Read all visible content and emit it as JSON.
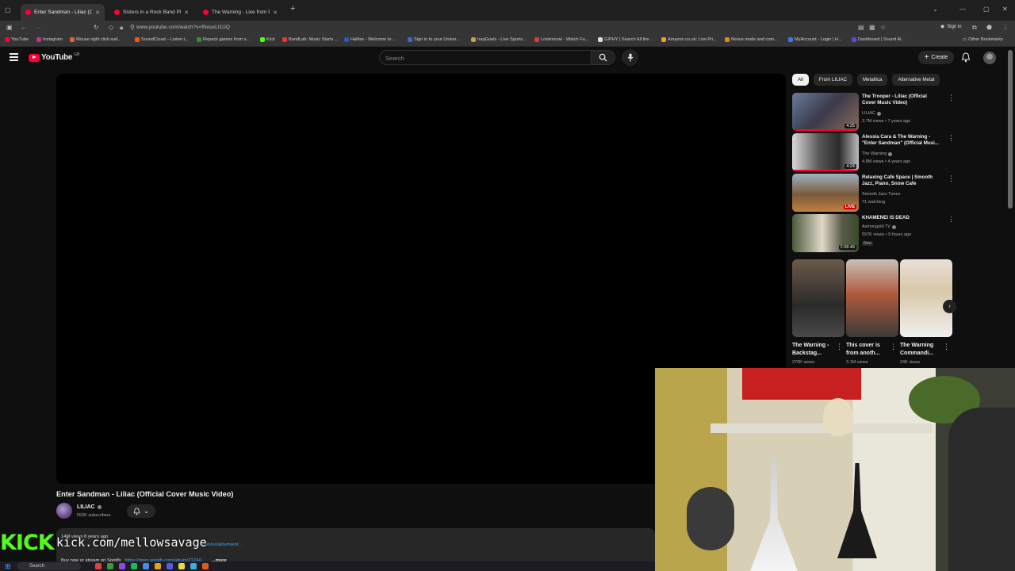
{
  "browser": {
    "tabs": [
      {
        "title": "Enter Sandman - Liliac (Official",
        "active": true
      },
      {
        "title": "Sisters in a Rock Band Play Trus",
        "active": false
      },
      {
        "title": "The Warning - Live from Pepsi",
        "active": false
      }
    ],
    "new_tab": "+",
    "url": "www.youtube.com/watch?v=fNouxLt1lJQ",
    "sign_in": "Sign in",
    "bookmarks": [
      {
        "label": "YouTube",
        "color": "#ff0033"
      },
      {
        "label": "Instagram",
        "color": "#c13584"
      },
      {
        "label": "Mouse right click sud...",
        "color": "#e0663a"
      },
      {
        "label": "SoundCloud – Listen t...",
        "color": "#ff5500"
      },
      {
        "label": "Repack games from s...",
        "color": "#3a8a3a"
      },
      {
        "label": "Kick",
        "color": "#53fc18"
      },
      {
        "label": "BandLab: Music Starts ...",
        "color": "#e03a3a"
      },
      {
        "label": "Halifax - Welcome to ...",
        "color": "#1f5fae"
      },
      {
        "label": "Sign in to your Univer...",
        "color": "#3a6bc9"
      },
      {
        "label": "IraqGoals - Live Sports...",
        "color": "#c9a03a"
      },
      {
        "label": "Lookmovie - Watch Fu...",
        "color": "#d04040"
      },
      {
        "label": "GIPHY | Search All the ...",
        "color": "#dddddd"
      },
      {
        "label": "Amazon.co.uk: Low Pri...",
        "color": "#f0a020"
      },
      {
        "label": "Nexus mods and com...",
        "color": "#e08a20"
      },
      {
        "label": "MyAccount - Login | H...",
        "color": "#3a7be0"
      },
      {
        "label": "Dashboard | Sound Al...",
        "color": "#5a4ae0"
      }
    ],
    "other_bookmarks": "Other Bookmarks"
  },
  "youtube": {
    "logo_word": "YouTube",
    "region": "GB",
    "search_placeholder": "Search",
    "create_label": "Create",
    "video": {
      "title": "Enter Sandman - Liliac (Official Cover Music Video)",
      "channel": "LILIAC",
      "subscribers": "552K subscribers",
      "meta": "14M views  8 years ago",
      "desc_link": ".com/us/album/ent...",
      "desc_line2": "Buy now or stream on Spotify",
      "desc_line2_link": "https://open.spotify.com/album/3TZ40..",
      "more": "...more"
    },
    "chips": [
      {
        "label": "All",
        "active": true
      },
      {
        "label": "From LILIAC",
        "active": false
      },
      {
        "label": "Metallica",
        "active": false
      },
      {
        "label": "Alternative Metal",
        "active": false
      }
    ],
    "recommendations": [
      {
        "title": "The Trooper - Liliac (Official Cover Music Video)",
        "channel": "LILIAC",
        "verified": true,
        "meta": "3.7M views • 7 years ago",
        "duration": "4:25",
        "badge": "",
        "progress": 1.0
      },
      {
        "title": "Alessia Cara & The Warning - \"Enter Sandman\" (Official Musi...",
        "channel": "The Warning",
        "verified": true,
        "meta": "4.8M views • 4 years ago",
        "duration": "4:24",
        "badge": "",
        "progress": 1.0
      },
      {
        "title": "Relaxing Cafe Space | Smooth Jazz, Piano, Snow Cafe",
        "channel": "Smooth Jazz Tunes",
        "verified": false,
        "meta": "71 watching",
        "duration": "LIVE",
        "badge": "",
        "progress": 0
      },
      {
        "title": "KHAMENEI IS DEAD",
        "channel": "Asmongold TV",
        "verified": true,
        "meta": "597K views • 9 hours ago",
        "duration": "2:08:49",
        "badge": "New",
        "progress": 0
      }
    ],
    "shorts": [
      {
        "title": "The Warning - Backstag...",
        "views": "370K views"
      },
      {
        "title": "This cover is from anoth...",
        "views": "3.1M views"
      },
      {
        "title": "The Warning Commandi...",
        "views": "24K views"
      }
    ]
  },
  "overlay": {
    "kick_logo": "KICK",
    "kick_url": "kick.com/mellowsavage"
  },
  "taskbar": {
    "search": "Search"
  }
}
